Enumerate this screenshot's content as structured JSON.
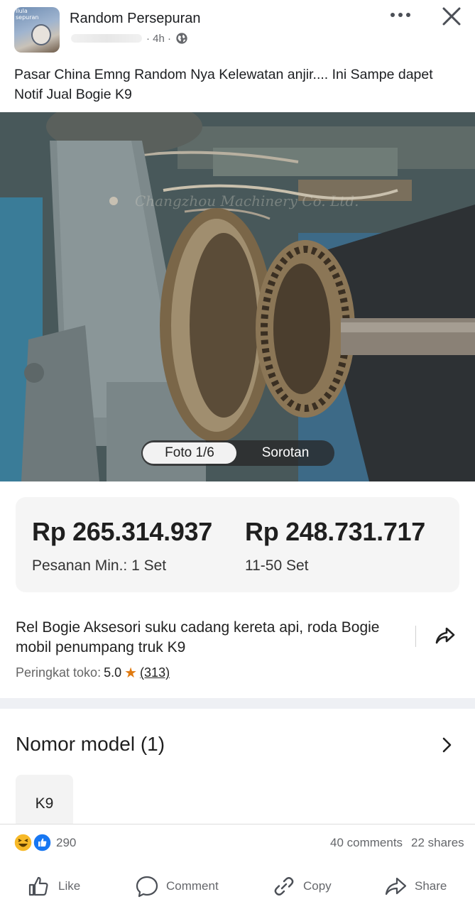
{
  "post": {
    "group_name": "Random Persepuran",
    "avatar_text": "Ilula\nsepuran",
    "time": "· 4h ·",
    "caption": "Pasar China Emng Random Nya Kelewatan anjir.... Ini Sampe dapet Notif Jual Bogie K9"
  },
  "icons": {
    "more": "more-horizontal-icon",
    "close": "close-icon",
    "audience": "globe-icon",
    "share_arrow": "share-arrow-icon",
    "star": "star-icon",
    "chevron": "chevron-right-icon"
  },
  "photo": {
    "watermark": "Changzhou Machinery Co. Ltd.",
    "tabs": [
      {
        "label": "Foto 1/6",
        "active": true
      },
      {
        "label": "Sorotan",
        "active": false
      }
    ]
  },
  "listing": {
    "price_1": "Rp 265.314.937",
    "price_1_note": "Pesanan Min.: 1 Set",
    "price_2": "Rp 248.731.717",
    "price_2_note": "11-50 Set",
    "title": "Rel Bogie Aksesori suku cadang kereta api, roda Bogie mobil penumpang truk K9",
    "rating_label": "Peringkat toko:",
    "rating_value": "5.0",
    "rating_star": "★",
    "rating_count": "(313)",
    "model_heading": "Nomor model (1)",
    "model_chip": "K9"
  },
  "stats": {
    "reaction_count": "290",
    "comments": "40 comments",
    "shares": "22 shares"
  },
  "actions": {
    "like": "Like",
    "comment": "Comment",
    "copy": "Copy",
    "share": "Share"
  },
  "colors": {
    "accent_blue": "#1877f2",
    "haha_yellow": "#f7b928",
    "star_orange": "#e07a10",
    "secondary_text": "#65676b"
  }
}
